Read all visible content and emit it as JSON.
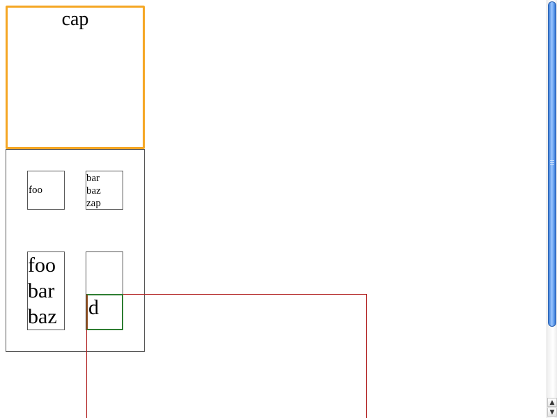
{
  "caption": {
    "text": "cap"
  },
  "table": {
    "cells": {
      "foo": "foo",
      "bar_baz_zap": [
        "bar",
        "baz",
        "zap"
      ],
      "foo_bar_baz": [
        "foo",
        "bar",
        "baz"
      ],
      "empty": ""
    }
  },
  "overflow_box": {
    "text": "d"
  },
  "scrollbar": {
    "up_arrow": "▲",
    "down_arrow": "▼"
  },
  "colors": {
    "caption_border": "#f5a623",
    "red_frame": "#b22222",
    "green_box": "#2e7d32",
    "scroll_thumb": "#3b7fd9"
  }
}
